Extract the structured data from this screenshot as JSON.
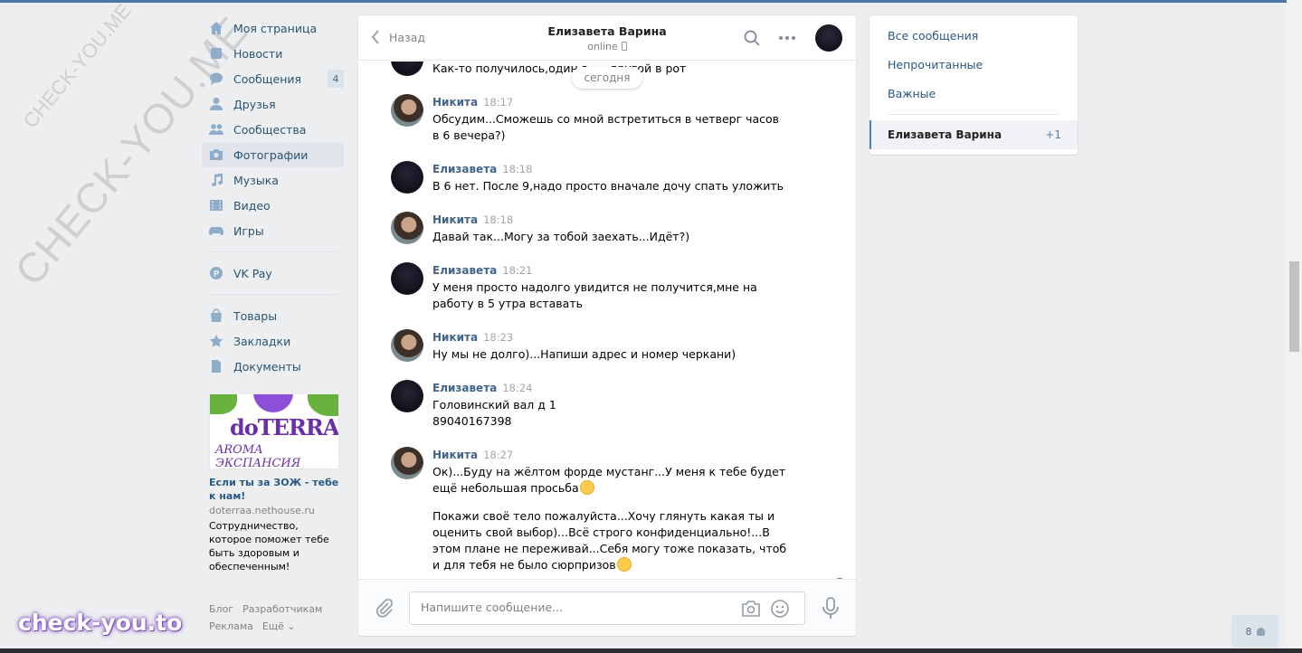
{
  "watermarks": {
    "diagonal_large": "CHECK-YOU.ME",
    "diagonal_small": "CHECK-YOU.ME",
    "bottom": "check-you.to"
  },
  "leftnav": {
    "items": [
      {
        "label": "Моя страница",
        "icon": "home-icon"
      },
      {
        "label": "Новости",
        "icon": "news-icon"
      },
      {
        "label": "Сообщения",
        "icon": "messages-icon",
        "badge": "4"
      },
      {
        "label": "Друзья",
        "icon": "friends-icon"
      },
      {
        "label": "Сообщества",
        "icon": "groups-icon"
      },
      {
        "label": "Фотографии",
        "icon": "camera-icon",
        "active": true
      },
      {
        "label": "Музыка",
        "icon": "music-icon"
      },
      {
        "label": "Видео",
        "icon": "video-icon"
      },
      {
        "label": "Игры",
        "icon": "games-icon"
      }
    ],
    "vkpay": {
      "label": "VK Pay",
      "icon": "vkpay-icon"
    },
    "extra": [
      {
        "label": "Товары",
        "icon": "bag-icon"
      },
      {
        "label": "Закладки",
        "icon": "star-icon"
      },
      {
        "label": "Документы",
        "icon": "document-icon"
      }
    ]
  },
  "ad": {
    "logo": "doTERRA",
    "logo_sub": "AROMA ЭКСПАНСИЯ",
    "title": "Если ты за ЗОЖ - тебе к нам!",
    "domain": "doterraa.nethouse.ru",
    "text": "Сотрудничество, которое поможет тебе быть здоровым и обеспеченным!"
  },
  "footer": {
    "links_row1": [
      "Блог",
      "Разработчикам"
    ],
    "links_row2": [
      "Реклама",
      "Ещё ⌄"
    ]
  },
  "chat": {
    "back_label": "Назад",
    "name": "Елизавета Варина",
    "status": "online",
    "today_label": "сегодня",
    "unread_count": "1",
    "input_placeholder": "Напишите сообщение...",
    "messages": [
      {
        "author": "",
        "time": "",
        "avatar": "eli",
        "text": [
          "Как-то получилось,один в ... ,другой в рот"
        ]
      },
      {
        "author": "Никита",
        "time": "18:17",
        "avatar": "nik",
        "text": [
          "Обсудим...Сможешь со мной встретиться в четверг часов в 6 вечера?)"
        ]
      },
      {
        "author": "Елизавета",
        "time": "18:18",
        "avatar": "eli",
        "text": [
          "В 6 нет. После 9,надо просто вначале дочу спать уложить"
        ]
      },
      {
        "author": "Никита",
        "time": "18:18",
        "avatar": "nik",
        "text": [
          "Давай так...Могу за тобой заехать...Идёт?)"
        ]
      },
      {
        "author": "Елизавета",
        "time": "18:21",
        "avatar": "eli",
        "text": [
          "У меня просто надолго увидится не получится,мне на работу в 5 утра вставать"
        ]
      },
      {
        "author": "Никита",
        "time": "18:23",
        "avatar": "nik",
        "text": [
          "Ну мы не долго)...Напиши адрес и номер черкани)"
        ]
      },
      {
        "author": "Елизавета",
        "time": "18:24",
        "avatar": "eli",
        "text": [
          "Головинский вал д 1\n89040167398"
        ]
      },
      {
        "author": "Никита",
        "time": "18:27",
        "avatar": "nik",
        "text": [
          "Ок)...Буду на жёлтом форде мустанг...У меня к тебе будет ещё небольшая просьба",
          "Покажи своё тело пожалуйста...Хочу глянуть какая ты и оценить свой выбор)...Всё строго конфиденциально!...В этом плане не переживай...Себя могу тоже показать, чтоб и для тебя не было сюрпризов"
        ]
      }
    ]
  },
  "rightpanel": {
    "all": "Все сообщения",
    "unread": "Непрочитанные",
    "important": "Важные",
    "active_name": "Елизавета Варина",
    "active_count": "+1"
  },
  "online_count": "8",
  "colors": {
    "accent": "#4a76a8",
    "link": "#2a5885",
    "bg": "#edeef0"
  }
}
